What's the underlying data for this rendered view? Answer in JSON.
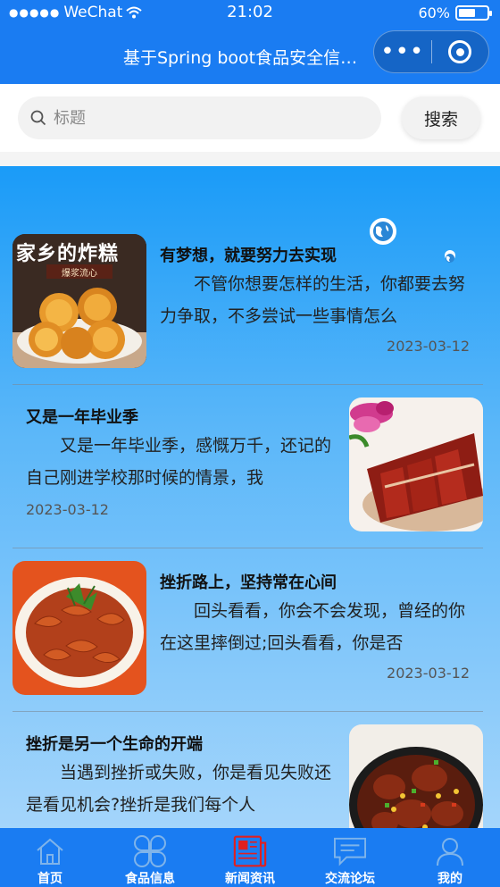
{
  "status_bar": {
    "carrier": "WeChat",
    "time": "21:02",
    "battery": "60%",
    "battery_level": 0.6
  },
  "nav": {
    "title": "基于Spring boot食品安全信息…",
    "more_icon": "ellipsis-icon",
    "close_icon": "target-icon"
  },
  "search": {
    "placeholder": "标题",
    "button_label": "搜索"
  },
  "news": [
    {
      "title": "有梦想，就要努力去实现",
      "summary": "不管你想要怎样的生活，你都要去努力争取，不多尝试一些事情怎么",
      "date": "2023-03-12",
      "image_text": "家乡的炸糕",
      "image_subtext": "爆浆流心"
    },
    {
      "title": "又是一年毕业季",
      "summary": "又是一年毕业季，感慨万千，还记的自己刚进学校那时候的情景，我",
      "date": "2023-03-12"
    },
    {
      "title": "挫折路上，坚持常在心间",
      "summary": "回头看看，你会不会发现，曾经的你在这里摔倒过;回头看看，你是否",
      "date": "2023-03-12"
    },
    {
      "title": "挫折是另一个生命的开端",
      "summary": "当遇到挫折或失败，你是看见失败还是看见机会?挫折是我们每个人",
      "date": ""
    }
  ],
  "tabs": [
    {
      "label": "首页",
      "icon": "home-icon"
    },
    {
      "label": "食品信息",
      "icon": "grid-flower-icon"
    },
    {
      "label": "新闻资讯",
      "icon": "newspaper-icon",
      "active": true
    },
    {
      "label": "交流论坛",
      "icon": "chat-icon"
    },
    {
      "label": "我的",
      "icon": "user-icon"
    }
  ],
  "colors": {
    "primary": "#1a7cf2",
    "active_tab": "#e02020"
  }
}
